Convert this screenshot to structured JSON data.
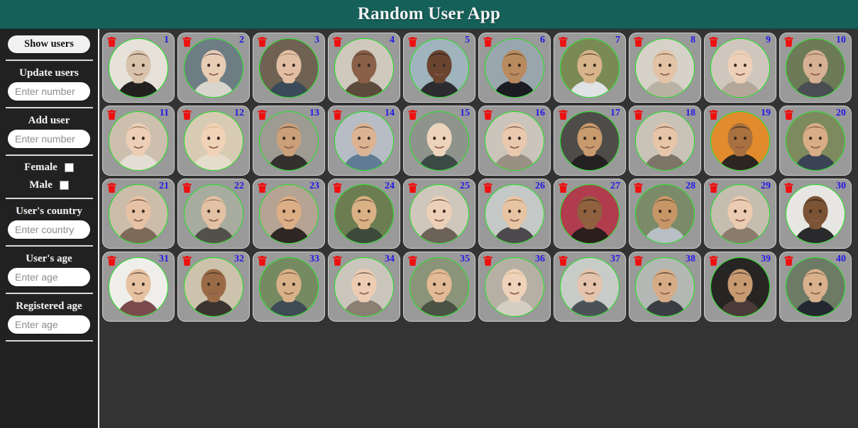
{
  "header": {
    "title": "Random User App",
    "bg_color": "#156059"
  },
  "colors": {
    "accent_teal": "#156059",
    "sidebar_bg": "#212121",
    "main_bg": "#333333",
    "card_bg": "#9a9a9a",
    "avatar_ring": "#18e818",
    "number_blue": "#2318e8",
    "trash_red": "#ee0f0f"
  },
  "sidebar": {
    "show_users_button": "Show users",
    "groups": [
      {
        "label": "Update users",
        "placeholder": "Enter number"
      },
      {
        "label": "Add user",
        "placeholder": "Enter number"
      },
      {
        "label": "User's country",
        "placeholder": "Enter country"
      },
      {
        "label": "User's age",
        "placeholder": "Enter age"
      },
      {
        "label": "Registered age",
        "placeholder": "Enter age"
      }
    ],
    "gender_filters": [
      {
        "label": "Female",
        "checked": false
      },
      {
        "label": "Male",
        "checked": false
      }
    ]
  },
  "grid": {
    "columns": 10,
    "rows": 4,
    "count": 40,
    "delete_icon": "trash-icon",
    "cards": [
      {
        "number": "1",
        "skin": "#d9c3ac",
        "hair": "#30211a",
        "bg": "#e6e2da",
        "shirt": "#22201f"
      },
      {
        "number": "2",
        "skin": "#e8cdb5",
        "hair": "#2b1b2a",
        "bg": "#6e7d84",
        "shirt": "#d8d5cd"
      },
      {
        "number": "3",
        "skin": "#e2bfa4",
        "hair": "#8d7355",
        "bg": "#6f6253",
        "shirt": "#3a4a58"
      },
      {
        "number": "4",
        "skin": "#8b6048",
        "hair": "#2a1c16",
        "bg": "#cfc9bd",
        "shirt": "#5c4a3c"
      },
      {
        "number": "5",
        "skin": "#6b4430",
        "hair": "#141018",
        "bg": "#9fb4bc",
        "shirt": "#2b2b30"
      },
      {
        "number": "6",
        "skin": "#b98a5e",
        "hair": "#1c1410",
        "bg": "#9aa6ae",
        "shirt": "#1b1b22"
      },
      {
        "number": "7",
        "skin": "#d8b48b",
        "hair": "#221a14",
        "bg": "#7a8a55",
        "shirt": "#e0e2e4"
      },
      {
        "number": "8",
        "skin": "#e3c3a6",
        "hair": "#5e4a34",
        "bg": "#d6d2c8",
        "shirt": "#b9b2a4"
      },
      {
        "number": "9",
        "skin": "#ecd0ba",
        "hair": "#cbb08a",
        "bg": "#cfc7bd",
        "shirt": "#b4a79a"
      },
      {
        "number": "10",
        "skin": "#d6b193",
        "hair": "#6a503a",
        "bg": "#6d7a58",
        "shirt": "#4a4e52"
      },
      {
        "number": "11",
        "skin": "#eccfb6",
        "hair": "#7c5d40",
        "bg": "#cdbfae",
        "shirt": "#e4ded4"
      },
      {
        "number": "12",
        "skin": "#f0d2b7",
        "hair": "#d6b37a",
        "bg": "#d8cbb4",
        "shirt": "#e6dccc"
      },
      {
        "number": "13",
        "skin": "#caa07a",
        "hair": "#231a14",
        "bg": "#9d9b92",
        "shirt": "#33302d"
      },
      {
        "number": "14",
        "skin": "#dcb494",
        "hair": "#2a2019",
        "bg": "#b6bdc4",
        "shirt": "#5f7c94"
      },
      {
        "number": "15",
        "skin": "#edd3bc",
        "hair": "#e0d6c2",
        "bg": "#8e938c",
        "shirt": "#3c4a46"
      },
      {
        "number": "16",
        "skin": "#e9c8ae",
        "hair": "#4a3326",
        "bg": "#cbc4ba",
        "shirt": "#9a8f83"
      },
      {
        "number": "17",
        "skin": "#c89a6e",
        "hair": "#181210",
        "bg": "#4e4c49",
        "shirt": "#232122"
      },
      {
        "number": "18",
        "skin": "#e6c5a9",
        "hair": "#4b3827",
        "bg": "#c9c2b6",
        "shirt": "#7e7468"
      },
      {
        "number": "19",
        "skin": "#a9713f",
        "hair": "#1b1411",
        "bg": "#e28b2c",
        "shirt": "#2c2520"
      },
      {
        "number": "20",
        "skin": "#d9ad86",
        "hair": "#5a3f2a",
        "bg": "#7d8a5e",
        "shirt": "#3a4454"
      },
      {
        "number": "21",
        "skin": "#e8c2a6",
        "hair": "#3a271c",
        "bg": "#cbbda9",
        "shirt": "#7d6a58"
      },
      {
        "number": "22",
        "skin": "#e3c1a4",
        "hair": "#7a6248",
        "bg": "#a8ac9e",
        "shirt": "#53504b"
      },
      {
        "number": "23",
        "skin": "#dcae86",
        "hair": "#1d1512",
        "bg": "#b5a393",
        "shirt": "#2e2723"
      },
      {
        "number": "24",
        "skin": "#d9b184",
        "hair": "#221a14",
        "bg": "#6d7d52",
        "shirt": "#3c4a3a"
      },
      {
        "number": "25",
        "skin": "#ecd0b8",
        "hair": "#2e2219",
        "bg": "#cfc7bb",
        "shirt": "#6c6258"
      },
      {
        "number": "26",
        "skin": "#e7c4a4",
        "hair": "#7d5b38",
        "bg": "#c4c8c6",
        "shirt": "#4c4a4c"
      },
      {
        "number": "27",
        "skin": "#90613f",
        "hair": "#1d1210",
        "bg": "#b03c4e",
        "shirt": "#2a1d1c"
      },
      {
        "number": "28",
        "skin": "#c79666",
        "hair": "#201712",
        "bg": "#7b8a68",
        "shirt": "#b8c0c6"
      },
      {
        "number": "29",
        "skin": "#ebcbb2",
        "hair": "#6b4a2e",
        "bg": "#c5bdb0",
        "shirt": "#8a7b6b"
      },
      {
        "number": "30",
        "skin": "#7b5335",
        "hair": "#161110",
        "bg": "#e8e6e2",
        "shirt": "#2a2a2c"
      },
      {
        "number": "31",
        "skin": "#e6c2a2",
        "hair": "#2b1e16",
        "bg": "#f0eeea",
        "shirt": "#7a4a4c"
      },
      {
        "number": "32",
        "skin": "#9a6a46",
        "hair": "#2b211a",
        "bg": "#cdc2ab",
        "shirt": "#3a3330"
      },
      {
        "number": "33",
        "skin": "#d9b189",
        "hair": "#4e3726",
        "bg": "#768a62",
        "shirt": "#3e4a54"
      },
      {
        "number": "34",
        "skin": "#eccdb4",
        "hair": "#3a2a1e",
        "bg": "#cbc6bc",
        "shirt": "#8a7f72"
      },
      {
        "number": "35",
        "skin": "#e2bb96",
        "hair": "#8a6a44",
        "bg": "#8a9478",
        "shirt": "#4a5244"
      },
      {
        "number": "36",
        "skin": "#eed2b9",
        "hair": "#c9a877",
        "bg": "#b6b0a4",
        "shirt": "#d4cec2"
      },
      {
        "number": "37",
        "skin": "#e4c4ac",
        "hair": "#3b2b20",
        "bg": "#c8ccc8",
        "shirt": "#4a5258"
      },
      {
        "number": "38",
        "skin": "#d5ac86",
        "hair": "#241a14",
        "bg": "#b4b8b4",
        "shirt": "#3a3e42"
      },
      {
        "number": "39",
        "skin": "#c79a72",
        "hair": "#1d1512",
        "bg": "#262524",
        "shirt": "#4a3a38"
      },
      {
        "number": "40",
        "skin": "#d8b08b",
        "hair": "#4c3a28",
        "bg": "#6c7a66",
        "shirt": "#232830"
      }
    ]
  }
}
